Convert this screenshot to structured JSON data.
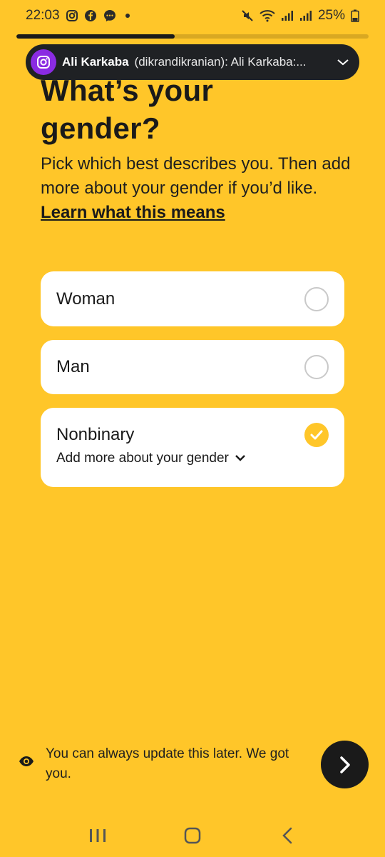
{
  "status_bar": {
    "time": "22:03",
    "battery": "25%",
    "left_icons": [
      "instagram-icon",
      "facebook-icon",
      "messenger-icon",
      "dot"
    ],
    "right_icons": [
      "mute-icon",
      "wifi-icon",
      "signal-icon",
      "signal-icon",
      "battery-icon"
    ]
  },
  "progress": {
    "value": 0.45
  },
  "notification": {
    "sender": "Ali Karkaba",
    "text": "(dikrandikranian): Ali Karkaba:..."
  },
  "page": {
    "title_line1": "What’s your",
    "title_line2": "gender?",
    "subtitle": "Pick which best describes you. Then add more about your gender if you’d like. ",
    "learn_link": "Learn what this means"
  },
  "options": [
    {
      "label": "Woman",
      "selected": false
    },
    {
      "label": "Man",
      "selected": false
    },
    {
      "label": "Nonbinary",
      "selected": true,
      "more_label": "Add more about your gender"
    }
  ],
  "footer": {
    "note": "You can always update this later. We got you."
  },
  "colors": {
    "background": "#FFC629",
    "accent": "#FFC629",
    "dark": "#1a1a1a",
    "card": "#FFFFFF"
  }
}
